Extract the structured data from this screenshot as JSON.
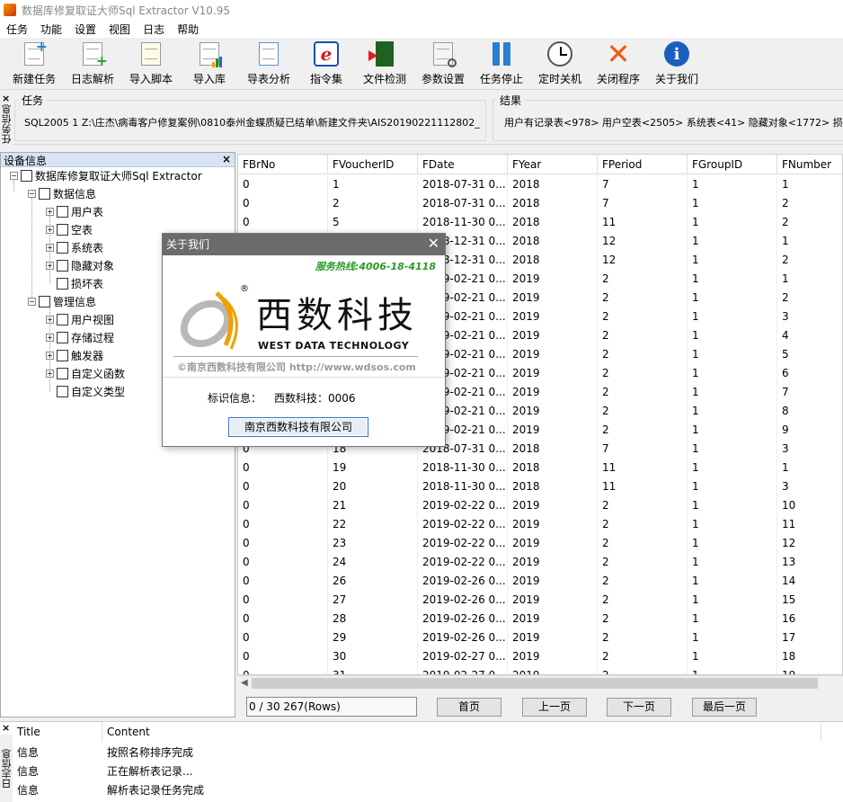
{
  "window": {
    "title": "数据库修复取证大师Sql Extractor V10.95"
  },
  "menu": [
    "任务",
    "功能",
    "设置",
    "视图",
    "日志",
    "帮助"
  ],
  "toolbar": {
    "new_task": "新建任务",
    "log_parse": "日志解析",
    "import_script": "导入脚本",
    "import_db": "导入库",
    "export_analysis": "导表分析",
    "command_set": "指令集",
    "file_check": "文件检测",
    "param_settings": "参数设置",
    "task_stop": "任务停止",
    "scheduled_shutdown": "定时关机",
    "close_program": "关闭程序",
    "about_us": "关于我们"
  },
  "task_panel": {
    "side_label": "任务信息",
    "task_title": "任务",
    "task_value": "SQL2005 1 Z:\\庄杰\\病毒客户修复案例\\0810泰州金蝶质疑已结单\\新建文件夹\\AIS20190221112802_",
    "result_title": "结果",
    "result_value": "用户有记录表<978> 用户空表<2505> 系统表<41> 隐藏对象<1772> 损"
  },
  "device": {
    "title": "设备信息",
    "root": "数据库修复取证大师Sql Extractor",
    "data_info": "数据信息",
    "data_children": [
      "用户表",
      "空表",
      "系统表",
      "隐藏对象",
      "损坏表"
    ],
    "mgmt_info": "管理信息",
    "mgmt_children": [
      "用户视图",
      "存储过程",
      "触发器",
      "自定义函数",
      "自定义类型"
    ]
  },
  "grid": {
    "columns": [
      "FBrNo",
      "FVoucherID",
      "FDate",
      "FYear",
      "FPeriod",
      "FGroupID",
      "FNumber"
    ],
    "rows": [
      [
        "0",
        "1",
        "2018-07-31 0...",
        "2018",
        "7",
        "1",
        "1"
      ],
      [
        "0",
        "2",
        "2018-07-31 0...",
        "2018",
        "7",
        "1",
        "2"
      ],
      [
        "0",
        "5",
        "2018-11-30 0...",
        "2018",
        "11",
        "1",
        "2"
      ],
      [
        "0",
        "",
        "2018-12-31 0...",
        "2018",
        "12",
        "1",
        "1"
      ],
      [
        "0",
        "",
        "2018-12-31 0...",
        "2018",
        "12",
        "1",
        "2"
      ],
      [
        "0",
        "",
        "2019-02-21 0...",
        "2019",
        "2",
        "1",
        "1"
      ],
      [
        "0",
        "",
        "2019-02-21 0...",
        "2019",
        "2",
        "1",
        "2"
      ],
      [
        "0",
        "",
        "2019-02-21 0...",
        "2019",
        "2",
        "1",
        "3"
      ],
      [
        "0",
        "",
        "2019-02-21 0...",
        "2019",
        "2",
        "1",
        "4"
      ],
      [
        "0",
        "",
        "2019-02-21 0...",
        "2019",
        "2",
        "1",
        "5"
      ],
      [
        "0",
        "",
        "2019-02-21 0...",
        "2019",
        "2",
        "1",
        "6"
      ],
      [
        "0",
        "",
        "2019-02-21 0...",
        "2019",
        "2",
        "1",
        "7"
      ],
      [
        "0",
        "",
        "2019-02-21 0...",
        "2019",
        "2",
        "1",
        "8"
      ],
      [
        "0",
        "",
        "2019-02-21 0...",
        "2019",
        "2",
        "1",
        "9"
      ],
      [
        "0",
        "18",
        "2018-07-31 0...",
        "2018",
        "7",
        "1",
        "3"
      ],
      [
        "0",
        "19",
        "2018-11-30 0...",
        "2018",
        "11",
        "1",
        "1"
      ],
      [
        "0",
        "20",
        "2018-11-30 0...",
        "2018",
        "11",
        "1",
        "3"
      ],
      [
        "0",
        "21",
        "2019-02-22 0...",
        "2019",
        "2",
        "1",
        "10"
      ],
      [
        "0",
        "22",
        "2019-02-22 0...",
        "2019",
        "2",
        "1",
        "11"
      ],
      [
        "0",
        "23",
        "2019-02-22 0...",
        "2019",
        "2",
        "1",
        "12"
      ],
      [
        "0",
        "24",
        "2019-02-22 0...",
        "2019",
        "2",
        "1",
        "13"
      ],
      [
        "0",
        "26",
        "2019-02-26 0...",
        "2019",
        "2",
        "1",
        "14"
      ],
      [
        "0",
        "27",
        "2019-02-26 0...",
        "2019",
        "2",
        "1",
        "15"
      ],
      [
        "0",
        "28",
        "2019-02-26 0...",
        "2019",
        "2",
        "1",
        "16"
      ],
      [
        "0",
        "29",
        "2019-02-26 0...",
        "2019",
        "2",
        "1",
        "17"
      ],
      [
        "0",
        "30",
        "2019-02-27 0...",
        "2019",
        "2",
        "1",
        "18"
      ],
      [
        "0",
        "31",
        "2019-02-27 0...",
        "2019",
        "2",
        "1",
        "19"
      ]
    ]
  },
  "pager": {
    "info": "0 / 30  267(Rows)",
    "first": "首页",
    "prev": "上一页",
    "next": "下一页",
    "last": "最后一页"
  },
  "log": {
    "side_label": "日志信息",
    "columns": [
      "Title",
      "Content"
    ],
    "rows": [
      [
        "信息",
        "按照名称排序完成"
      ],
      [
        "信息",
        "正在解析表记录..."
      ],
      [
        "信息",
        "解析表记录任务完成"
      ]
    ]
  },
  "dialog": {
    "title": "关于我们",
    "hotline": "服务热线:4006-18-4118",
    "brand_cn": "西数科技",
    "brand_en": "WEST DATA TECHNOLOGY",
    "registered": "®",
    "copyright": "©南京西数科技有限公司  http://www.wdsos.com",
    "id_label": "标识信息：",
    "id_value": "西数科技：0006",
    "button": "南京西数科技有限公司"
  },
  "colors": {
    "accent_orange": "#f0a000",
    "hotline_green": "#2a9a2a",
    "dialog_title": "#6b6b6b"
  }
}
